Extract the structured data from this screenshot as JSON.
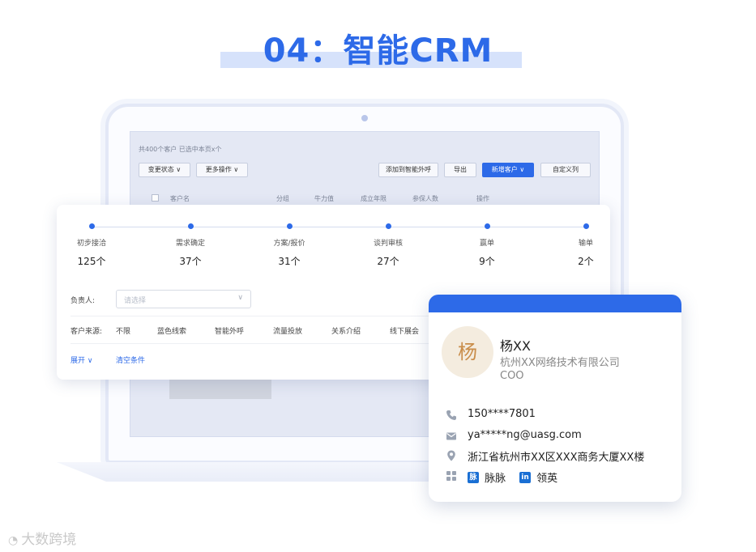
{
  "title": "04：智能CRM",
  "screen": {
    "summary": "共400个客户  已选中本页x个",
    "buttons": {
      "change_status": "变更状态 ∨",
      "more_actions": "更多操作 ∨",
      "add_ai_call": "添加到智能外呼",
      "export": "导出",
      "new_customer": "新增客户 ∨",
      "custom_columns": "自定义列"
    },
    "columns": [
      "客户名",
      "分组",
      "牛力值",
      "成立年限",
      "参保人数",
      "操作"
    ]
  },
  "funnel": {
    "stages": [
      {
        "name": "初步接洽",
        "count": "125个"
      },
      {
        "name": "需求确定",
        "count": "37个"
      },
      {
        "name": "方案/报价",
        "count": "31个"
      },
      {
        "name": "谈判审核",
        "count": "27个"
      },
      {
        "name": "赢单",
        "count": "9个"
      },
      {
        "name": "输单",
        "count": "2个"
      }
    ],
    "owner_label": "负责人:",
    "owner_placeholder": "请选择",
    "source_label": "客户来源:",
    "sources": [
      "不限",
      "蓝色线索",
      "智能外呼",
      "流量投放",
      "关系介绍",
      "线下展会"
    ],
    "expand": "展开 ∨",
    "clear": "清空条件"
  },
  "contact": {
    "avatar_char": "杨",
    "name": "杨XX",
    "company": "杭州XX网络技术有限公司",
    "role": "COO",
    "phone": "150****7801",
    "email": "ya*****ng@uasg.com",
    "address": "浙江省杭州市XX区XXX商务大厦XX楼",
    "socials": [
      {
        "badge": "脉",
        "label": "脉脉"
      },
      {
        "badge": "in",
        "label": "领英"
      }
    ]
  },
  "watermark": "大数跨境",
  "colors": {
    "accent": "#2d6ae8",
    "title_highlight": "#d6e2fb",
    "avatar_bg": "#f4ecdf",
    "avatar_fg": "#c98d4a"
  }
}
